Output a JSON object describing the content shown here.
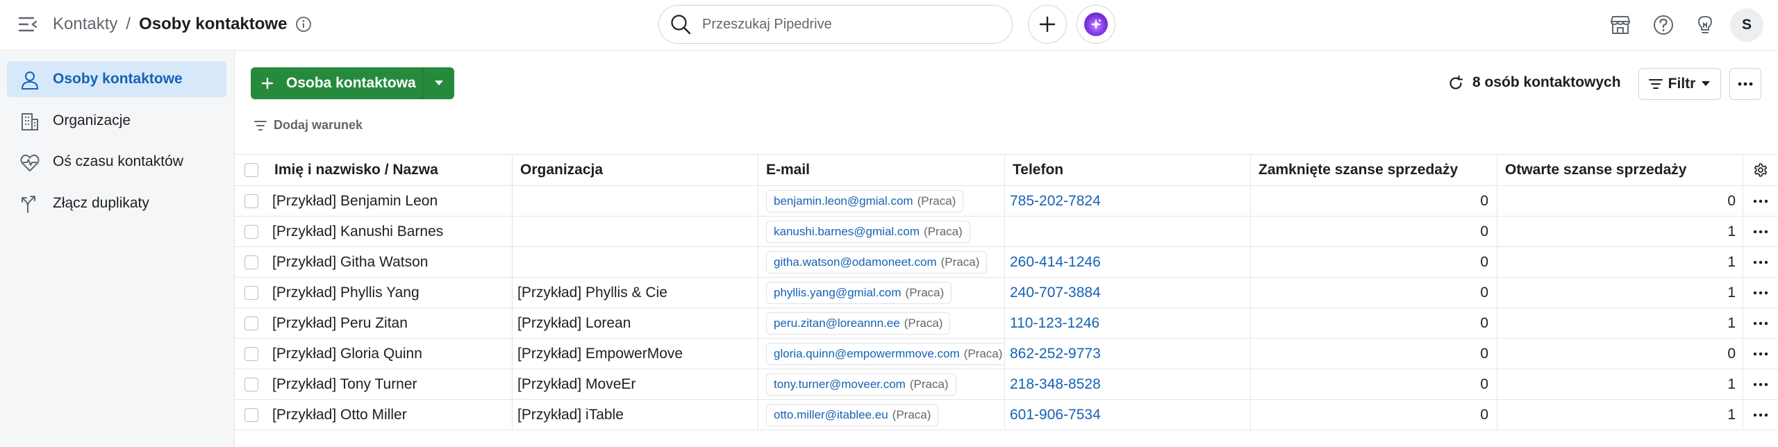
{
  "breadcrumb": {
    "root": "Kontakty",
    "separator": "/",
    "current": "Osoby kontaktowe"
  },
  "search": {
    "placeholder": "Przeszukaj Pipedrive"
  },
  "user": {
    "initial": "S"
  },
  "sidebar": {
    "items": [
      {
        "label": "Osoby kontaktowe",
        "icon": "person-icon",
        "active": true
      },
      {
        "label": "Organizacje",
        "icon": "building-icon",
        "active": false
      },
      {
        "label": "Oś czasu kontaktów",
        "icon": "heart-pulse-icon",
        "active": false
      },
      {
        "label": "Złącz duplikaty",
        "icon": "merge-icon",
        "active": false
      }
    ]
  },
  "toolbar": {
    "add_label": "Osoba kontaktowa",
    "count_label": "8 osób kontaktowych",
    "filter_label": "Filtr",
    "add_condition": "Dodaj warunek"
  },
  "table": {
    "columns": {
      "name": "Imię i nazwisko / Nazwa",
      "org": "Organizacja",
      "email": "E-mail",
      "phone": "Telefon",
      "won": "Zamknięte szanse sprzedaży",
      "open": "Otwarte szanse sprzedaży"
    },
    "rows": [
      {
        "name": "[Przykład] Benjamin Leon",
        "org": "",
        "email": "benjamin.leon@gmial.com",
        "email_type": "(Praca)",
        "phone": "785-202-7824",
        "won": "0",
        "open": "0"
      },
      {
        "name": "[Przykład] Kanushi Barnes",
        "org": "",
        "email": "kanushi.barnes@gmial.com",
        "email_type": "(Praca)",
        "phone": "",
        "won": "0",
        "open": "1"
      },
      {
        "name": "[Przykład] Githa Watson",
        "org": "",
        "email": "githa.watson@odamoneet.com",
        "email_type": "(Praca)",
        "phone": "260-414-1246",
        "won": "0",
        "open": "1"
      },
      {
        "name": "[Przykład] Phyllis Yang",
        "org": "[Przykład] Phyllis & Cie",
        "email": "phyllis.yang@gmial.com",
        "email_type": "(Praca)",
        "phone": "240-707-3884",
        "won": "0",
        "open": "1"
      },
      {
        "name": "[Przykład] Peru Zitan",
        "org": "[Przykład] Lorean",
        "email": "peru.zitan@loreannn.ee",
        "email_type": "(Praca)",
        "phone": "110-123-1246",
        "won": "0",
        "open": "1"
      },
      {
        "name": "[Przykład] Gloria Quinn",
        "org": "[Przykład] EmpowerMove",
        "email": "gloria.quinn@empowermmove.com",
        "email_type": "(Praca)",
        "phone": "862-252-9773",
        "won": "0",
        "open": "0"
      },
      {
        "name": "[Przykład] Tony Turner",
        "org": "[Przykład] MoveEr",
        "email": "tony.turner@moveer.com",
        "email_type": "(Praca)",
        "phone": "218-348-8528",
        "won": "0",
        "open": "1"
      },
      {
        "name": "[Przykład] Otto Miller",
        "org": "[Przykład] iTable",
        "email": "otto.miller@itablee.eu",
        "email_type": "(Praca)",
        "phone": "601-906-7534",
        "won": "0",
        "open": "1"
      }
    ]
  },
  "colors": {
    "accent_green": "#268a3d",
    "link_blue": "#1562b4",
    "active_bg": "#d7e8fb"
  }
}
